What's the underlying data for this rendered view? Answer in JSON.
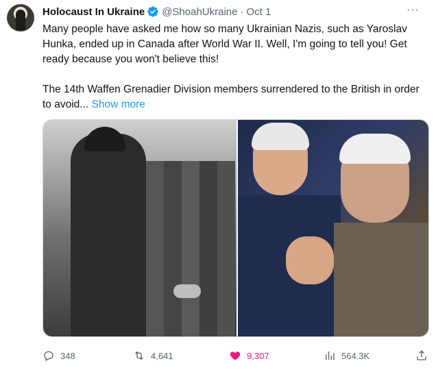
{
  "tweet": {
    "display_name": "Holocaust In Ukraine",
    "handle": "@ShoahUkraine",
    "separator": "·",
    "date": "Oct 1",
    "more_label": "···",
    "paragraph_1": "Many people have asked me how so many Ukrainian Nazis, such as Yaroslav Hunka, ended up in Canada after World War II. Well, I'm going to tell you! Get ready because you won't believe this!",
    "paragraph_2": "The 14th Waffen Grenadier Division members surrendered to the British in order to avoid...",
    "show_more": "Show more"
  },
  "media": {
    "left_photo": "black-and-white-soldiers-handshake",
    "right_photo": "color-men-applauding"
  },
  "actions": {
    "replies": "348",
    "retweets": "4,641",
    "likes": "9,307",
    "views": "564.3K"
  },
  "icons": {
    "verified": "verified-badge-icon",
    "reply": "reply-icon",
    "retweet": "retweet-icon",
    "like": "heart-icon",
    "views": "views-icon",
    "share": "share-icon"
  },
  "colors": {
    "accent": "#1d9bf0",
    "like": "#f91880",
    "secondary_text": "#536471"
  }
}
